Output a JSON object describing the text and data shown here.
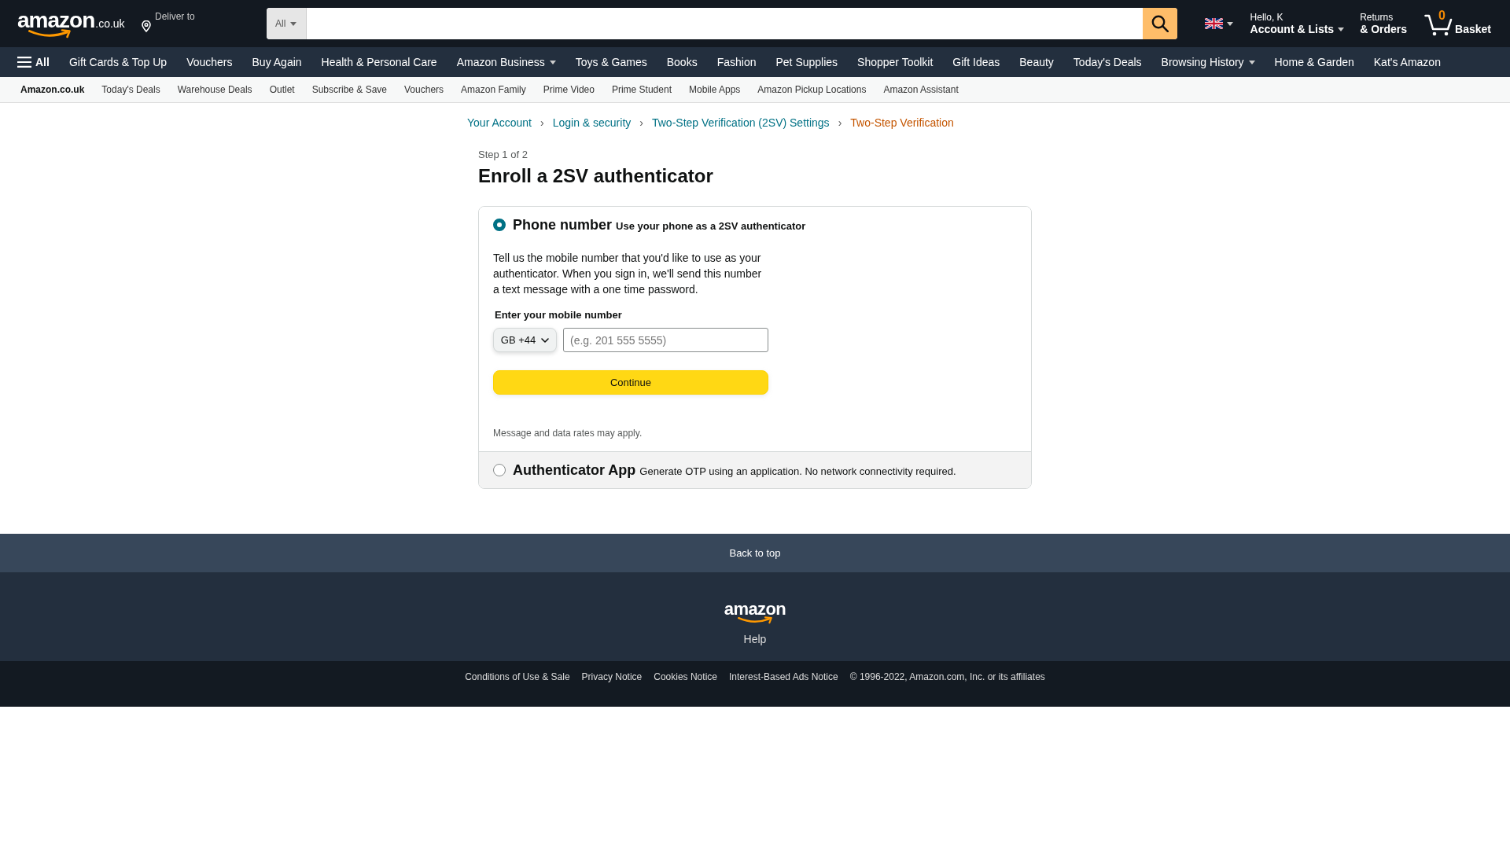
{
  "header": {
    "logo": {
      "wordmark": "amazon",
      "domain": ".co.uk"
    },
    "deliver_to": "Deliver to",
    "search": {
      "category": "All"
    },
    "account": {
      "greeting": "Hello, K",
      "label": "Account & Lists"
    },
    "returns": {
      "line_1": "Returns",
      "line_2": "& Orders"
    },
    "basket": {
      "count": "0",
      "label": "Basket"
    }
  },
  "nav": {
    "menu": "All",
    "items": [
      {
        "label": "Gift Cards & Top Up",
        "dropdown": false
      },
      {
        "label": "Vouchers",
        "dropdown": false
      },
      {
        "label": "Buy Again",
        "dropdown": false
      },
      {
        "label": "Health & Personal Care",
        "dropdown": false
      },
      {
        "label": "Amazon Business",
        "dropdown": true
      },
      {
        "label": "Toys & Games",
        "dropdown": false
      },
      {
        "label": "Books",
        "dropdown": false
      },
      {
        "label": "Fashion",
        "dropdown": false
      },
      {
        "label": "Pet Supplies",
        "dropdown": false
      },
      {
        "label": "Shopper Toolkit",
        "dropdown": false
      },
      {
        "label": "Gift Ideas",
        "dropdown": false
      },
      {
        "label": "Beauty",
        "dropdown": false
      },
      {
        "label": "Today's Deals",
        "dropdown": false
      },
      {
        "label": "Browsing History",
        "dropdown": true
      },
      {
        "label": "Home & Garden",
        "dropdown": false
      },
      {
        "label": "Kat's Amazon",
        "dropdown": false
      }
    ]
  },
  "subnav": {
    "items": [
      {
        "label": "Amazon.co.uk",
        "selected": true
      },
      {
        "label": "Today's Deals",
        "selected": false
      },
      {
        "label": "Warehouse Deals",
        "selected": false
      },
      {
        "label": "Outlet",
        "selected": false
      },
      {
        "label": "Subscribe & Save",
        "selected": false
      },
      {
        "label": "Vouchers",
        "selected": false
      },
      {
        "label": "Amazon Family",
        "selected": false
      },
      {
        "label": "Prime Video",
        "selected": false
      },
      {
        "label": "Prime Student",
        "selected": false
      },
      {
        "label": "Mobile Apps",
        "selected": false
      },
      {
        "label": "Amazon Pickup Locations",
        "selected": false
      },
      {
        "label": "Amazon Assistant",
        "selected": false
      }
    ]
  },
  "breadcrumb": {
    "items": [
      {
        "label": "Your Account",
        "current": false
      },
      {
        "label": "Login & security",
        "current": false
      },
      {
        "label": "Two-Step Verification (2SV) Settings",
        "current": false
      },
      {
        "label": "Two-Step Verification",
        "current": true
      }
    ],
    "separators": [
      "›",
      "›",
      "›"
    ]
  },
  "step": "Step 1 of 2",
  "title": "Enroll a 2SV authenticator",
  "options": [
    {
      "kind": "phone",
      "selected": true,
      "title": "Phone number",
      "subtitle": "Use your phone as a 2SV authenticator",
      "details": {
        "description": "Tell us the mobile number that you'd like to use as your authenticator. When you sign in, we'll send this number a text message with a one time password.",
        "field_label": "Enter your mobile number",
        "country_code": "GB +44",
        "placeholder": "(e.g. 201 555 5555)",
        "button": "Continue",
        "note": "Message and data rates may apply."
      }
    },
    {
      "kind": "app",
      "selected": false,
      "title": "Authenticator App",
      "subtitle": "Generate OTP using an application. No network connectivity required."
    }
  ],
  "footer": {
    "back_to_top": "Back to top",
    "logo": "amazon",
    "help": "Help",
    "links": [
      "Conditions of Use & Sale",
      "Privacy Notice",
      "Cookies Notice",
      "Interest-Based Ads Notice"
    ],
    "copyright": "© 1996-2022, Amazon.com, Inc. or its affiliates"
  }
}
